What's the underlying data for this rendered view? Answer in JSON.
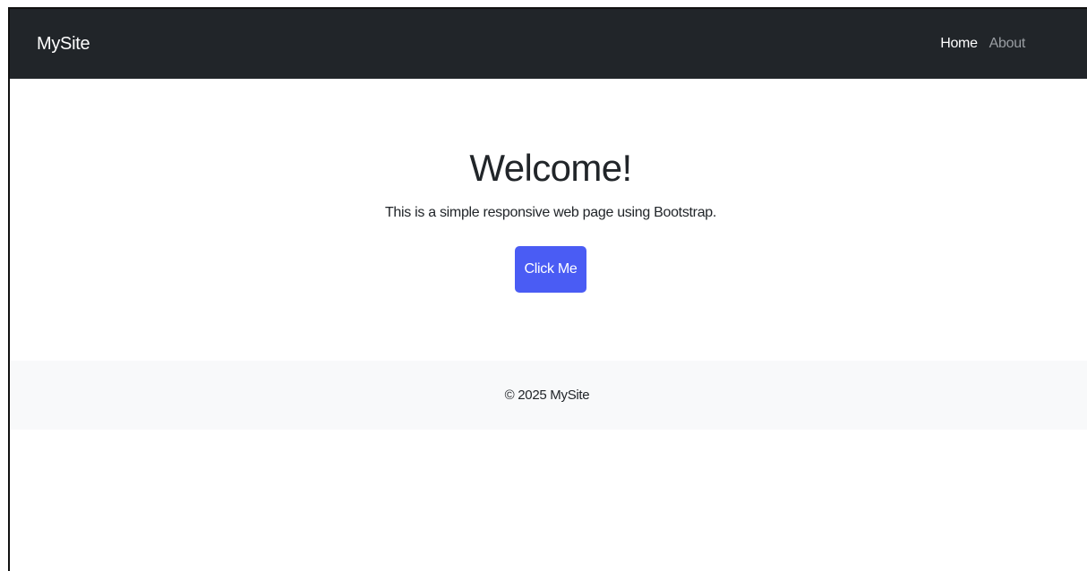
{
  "navbar": {
    "brand": "MySite",
    "links": [
      {
        "label": "Home",
        "active": true
      },
      {
        "label": "About",
        "active": false
      }
    ],
    "background_color": "#212529"
  },
  "hero": {
    "title": "Welcome!",
    "subtitle": "This is a simple responsive web page using Bootstrap.",
    "button_label": "Click Me",
    "button_color": "#4a5cf4"
  },
  "footer": {
    "text": "© 2025 MySite",
    "background_color": "#f8f9fa"
  }
}
